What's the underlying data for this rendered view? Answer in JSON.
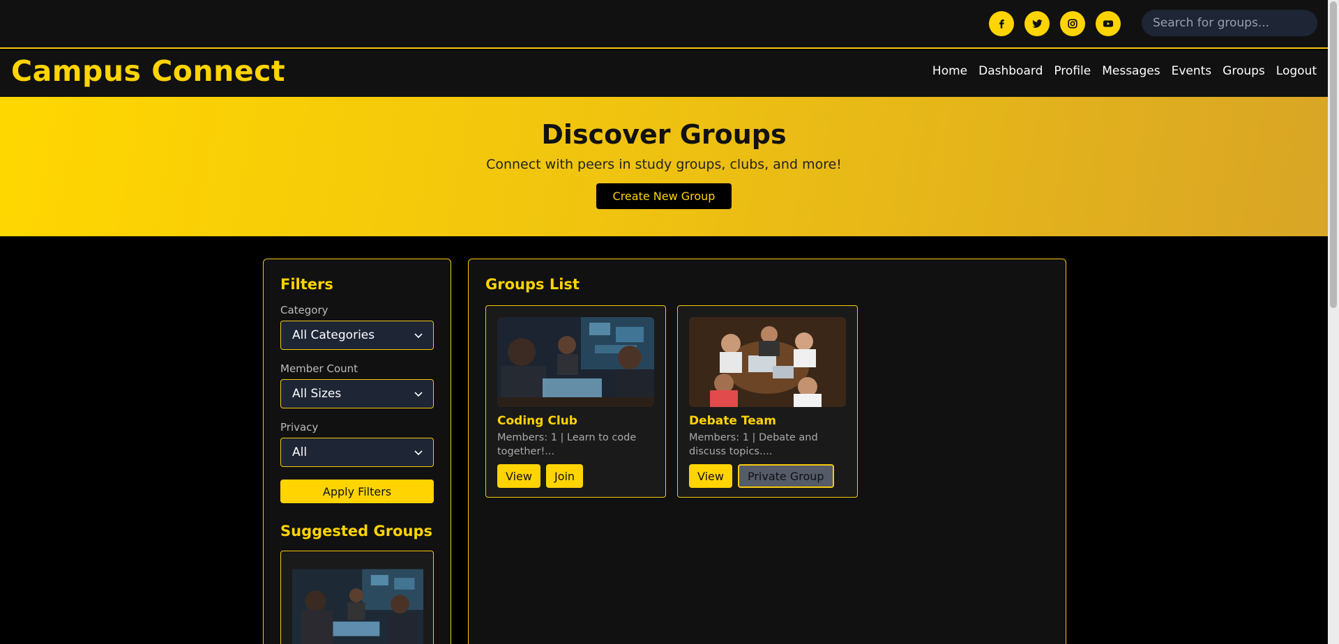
{
  "top_bar": {
    "social": [
      {
        "name": "facebook-icon"
      },
      {
        "name": "twitter-icon"
      },
      {
        "name": "instagram-icon"
      },
      {
        "name": "youtube-icon"
      }
    ],
    "search_placeholder": "Search for groups..."
  },
  "navbar": {
    "brand": "Campus Connect",
    "links": [
      "Home",
      "Dashboard",
      "Profile",
      "Messages",
      "Events",
      "Groups",
      "Logout"
    ]
  },
  "hero": {
    "title": "Discover Groups",
    "subtitle": "Connect with peers in study groups, clubs, and more!",
    "button": "Create New Group"
  },
  "filters": {
    "title": "Filters",
    "category_label": "Category",
    "category_value": "All Categories",
    "member_label": "Member Count",
    "member_value": "All Sizes",
    "privacy_label": "Privacy",
    "privacy_value": "All",
    "apply_label": "Apply Filters",
    "suggested_title": "Suggested Groups"
  },
  "groups": {
    "title": "Groups List",
    "items": [
      {
        "name": "Coding Club",
        "desc": "Members: 1 | Learn to code together!...",
        "view": "View",
        "action": "Join"
      },
      {
        "name": "Debate Team",
        "desc": "Members: 1 | Debate and discuss topics....",
        "view": "View",
        "action": "Private Group"
      }
    ]
  },
  "colors": {
    "accent": "#ffd400",
    "background": "#000000",
    "panel": "#111111"
  }
}
